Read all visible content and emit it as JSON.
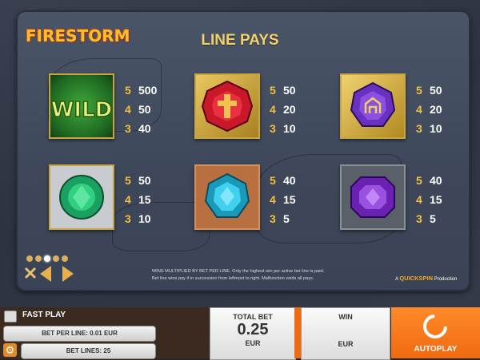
{
  "game": {
    "logo": "FIRESTORM",
    "title": "LINE PAYS"
  },
  "symbols": [
    {
      "name": "wild",
      "pays": [
        {
          "n": "5",
          "v": "500"
        },
        {
          "n": "4",
          "v": "50"
        },
        {
          "n": "3",
          "v": "40"
        }
      ]
    },
    {
      "name": "red-gem",
      "pays": [
        {
          "n": "5",
          "v": "50"
        },
        {
          "n": "4",
          "v": "20"
        },
        {
          "n": "3",
          "v": "10"
        }
      ]
    },
    {
      "name": "purple-gem",
      "pays": [
        {
          "n": "5",
          "v": "50"
        },
        {
          "n": "4",
          "v": "20"
        },
        {
          "n": "3",
          "v": "10"
        }
      ]
    },
    {
      "name": "green-gem",
      "pays": [
        {
          "n": "5",
          "v": "50"
        },
        {
          "n": "4",
          "v": "15"
        },
        {
          "n": "3",
          "v": "10"
        }
      ]
    },
    {
      "name": "cyan-gem",
      "pays": [
        {
          "n": "5",
          "v": "40"
        },
        {
          "n": "4",
          "v": "15"
        },
        {
          "n": "3",
          "v": "5"
        }
      ]
    },
    {
      "name": "violet-gem",
      "pays": [
        {
          "n": "5",
          "v": "40"
        },
        {
          "n": "4",
          "v": "15"
        },
        {
          "n": "3",
          "v": "5"
        }
      ]
    }
  ],
  "wild_text": "WILD",
  "fine_print": [
    "WINS MULTIPLIED BY BET PER LINE. Only the highest win per active bet line is paid.",
    "Bet line wins pay if in succession from leftmost to right. Malfunction voids all pays."
  ],
  "brand": {
    "prefix": "A",
    "name": "QUICKSPIN",
    "suffix": "Production"
  },
  "controls": {
    "fast_play": "FAST PLAY",
    "bet_per_line": "BET PER LINE: 0.01 EUR",
    "bet_lines": "BET LINES: 25",
    "total_bet_label": "TOTAL BET",
    "total_bet_value": "0.25",
    "total_bet_currency": "EUR",
    "win_label": "WIN",
    "win_currency": "EUR",
    "autoplay": "AUTOPLAY"
  },
  "pagination": {
    "pages": 5,
    "active": 3
  },
  "icons": {
    "close": "close-icon",
    "prev": "arrow-left-icon",
    "next": "arrow-right-icon",
    "settings": "gear-icon",
    "spin": "spin-icon"
  },
  "colors": {
    "accent": "#f06a10",
    "gold": "#c9a440",
    "title": "#f2d06a"
  }
}
